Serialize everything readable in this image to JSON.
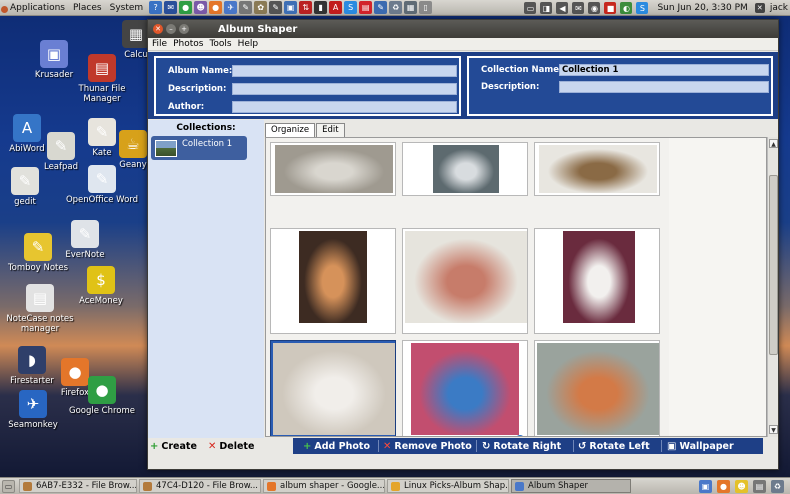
{
  "top_panel": {
    "menus": [
      "Applications",
      "Places",
      "System"
    ],
    "launchers": [
      {
        "icon": "help-icon",
        "glyph": "?",
        "color": "#3a72c4"
      },
      {
        "icon": "thunderbird-icon",
        "glyph": "✉",
        "color": "#2a4f9a"
      },
      {
        "icon": "chrome-icon",
        "glyph": "●",
        "color": "#2f9e44"
      },
      {
        "icon": "pidgin-icon",
        "glyph": "☻",
        "color": "#7a5aa8"
      },
      {
        "icon": "firefox-icon",
        "glyph": "●",
        "color": "#e4762a"
      },
      {
        "icon": "plane-icon",
        "glyph": "✈",
        "color": "#4a78c9"
      },
      {
        "icon": "text-editor-icon",
        "glyph": "✎",
        "color": "#777"
      },
      {
        "icon": "gimp-icon",
        "glyph": "✿",
        "color": "#8a7a55"
      },
      {
        "icon": "edit-icon",
        "glyph": "✎",
        "color": "#555"
      },
      {
        "icon": "monitor-icon",
        "glyph": "▣",
        "color": "#3e6fb5"
      },
      {
        "icon": "filezilla-icon",
        "glyph": "⇅",
        "color": "#b22"
      },
      {
        "icon": "terminal-icon",
        "glyph": "▮",
        "color": "#333"
      },
      {
        "icon": "acrobat-icon",
        "glyph": "A",
        "color": "#c21d1d"
      },
      {
        "icon": "skype-icon",
        "glyph": "S",
        "color": "#2a8be0"
      },
      {
        "icon": "pdf-icon",
        "glyph": "▤",
        "color": "#d2232a"
      },
      {
        "icon": "writer-icon",
        "glyph": "✎",
        "color": "#3c6bb0"
      },
      {
        "icon": "trash-icon",
        "glyph": "♻",
        "color": "#6d7b8d"
      },
      {
        "icon": "calculator-icon",
        "glyph": "▦",
        "color": "#5f6b75"
      },
      {
        "icon": "file-icon",
        "glyph": "▯",
        "color": "#8a8a8a"
      }
    ],
    "tray": [
      {
        "icon": "battery-icon",
        "glyph": "▭",
        "color": "#555"
      },
      {
        "icon": "network-icon",
        "glyph": "◨",
        "color": "#555"
      },
      {
        "icon": "volume-icon",
        "glyph": "◀",
        "color": "#555"
      },
      {
        "icon": "mail-icon",
        "glyph": "✉",
        "color": "#555"
      },
      {
        "icon": "wifi-icon",
        "glyph": "◉",
        "color": "#555"
      },
      {
        "icon": "record-icon",
        "glyph": "■",
        "color": "#c6281e"
      },
      {
        "icon": "chat-icon",
        "glyph": "◐",
        "color": "#3c8d3c"
      },
      {
        "icon": "skype-tray-icon",
        "glyph": "S",
        "color": "#2a8be0"
      }
    ],
    "clock": "Sun Jun 20,  3:30 PM",
    "user": "jack"
  },
  "desktop_icons": [
    {
      "name": "krusader",
      "label": "Krusader",
      "glyph": "▣",
      "color": "#6a7fd3"
    },
    {
      "name": "calculator",
      "label": "Calcu",
      "glyph": "▦",
      "color": "#444"
    },
    {
      "name": "thunar",
      "label": "Thunar File Manager",
      "glyph": "▤",
      "color": "#c0392b"
    },
    {
      "name": "abiword",
      "label": "AbiWord",
      "glyph": "A",
      "color": "#3575c7"
    },
    {
      "name": "leafpad",
      "label": "Leafpad",
      "glyph": "✎",
      "color": "#d8d8d0"
    },
    {
      "name": "kate",
      "label": "Kate",
      "glyph": "✎",
      "color": "#e7e4dd"
    },
    {
      "name": "geany",
      "label": "Geany",
      "glyph": "☕",
      "color": "#d7a11a"
    },
    {
      "name": "gedit",
      "label": "gedit",
      "glyph": "✎",
      "color": "#e1e1dc"
    },
    {
      "name": "openoffice-writer",
      "label": "OpenOffice Word",
      "glyph": "✎",
      "color": "#dfe6ef"
    },
    {
      "name": "tomboy",
      "label": "Tomboy Notes",
      "glyph": "✎",
      "color": "#e7c52f"
    },
    {
      "name": "evernote",
      "label": "EverNote",
      "glyph": "✎",
      "color": "#dfe3e8"
    },
    {
      "name": "acemoney",
      "label": "AceMoney",
      "glyph": "$",
      "color": "#e0c216"
    },
    {
      "name": "notecase",
      "label": "NoteCase notes manager",
      "glyph": "▤",
      "color": "#e2e2e2"
    },
    {
      "name": "firestarter",
      "label": "Firestarter",
      "glyph": "◗",
      "color": "#2f3f6a"
    },
    {
      "name": "firefox",
      "label": "Firefox",
      "glyph": "●",
      "color": "#e4762a"
    },
    {
      "name": "seamonkey",
      "label": "Seamonkey",
      "glyph": "✈",
      "color": "#2866c2"
    },
    {
      "name": "chrome",
      "label": "Google Chrome",
      "glyph": "●",
      "color": "#2f9e44"
    }
  ],
  "window": {
    "title": "Album Shaper",
    "menu": [
      "File",
      "Photos",
      "Tools",
      "Help"
    ],
    "album": {
      "name_label": "Album Name:",
      "name_value": "",
      "description_label": "Description:",
      "description_value": "",
      "author_label": "Author:",
      "author_value": ""
    },
    "collection": {
      "name_label": "Collection Name:",
      "name_value": "Collection 1",
      "description_label": "Description:",
      "description_value": ""
    },
    "collections_heading": "Collections:",
    "collections": [
      {
        "label": "Collection 1"
      }
    ],
    "tabs": [
      "Organize",
      "Edit"
    ],
    "photos": [
      {
        "name": "photo-computer-desk",
        "selected": false,
        "bg": "#9f9a90",
        "fg": "#d9d6cf"
      },
      {
        "name": "photo-deck-scene",
        "selected": false,
        "bg": "#5d6a6f",
        "fg": "#d8dcdf"
      },
      {
        "name": "photo-door-wreath",
        "selected": false,
        "bg": "#e8e6e0",
        "fg": "#8a6a45"
      },
      {
        "name": "photo-lamp-flowers",
        "selected": false,
        "bg": "#3d2b22",
        "fg": "#d6925a"
      },
      {
        "name": "photo-white-pillows",
        "selected": false,
        "bg": "#e6e4dd",
        "fg": "#c77c6a"
      },
      {
        "name": "photo-wedding-couple",
        "selected": false,
        "bg": "#6a2b3e",
        "fg": "#f2f0ee"
      },
      {
        "name": "photo-family-couch",
        "selected": true,
        "bg": "#cfc8bd",
        "fg": "#f1eeea"
      },
      {
        "name": "photo-baby-hat",
        "selected": false,
        "bg": "#c24e6f",
        "fg": "#3b7bc5"
      },
      {
        "name": "photo-office-computer",
        "selected": false,
        "bg": "#9aa39d",
        "fg": "#d37a47"
      }
    ],
    "info_badge": "i",
    "buttons": {
      "create": "Create",
      "delete": "Delete",
      "add_photo": "Add Photo",
      "remove_photo": "Remove Photo",
      "rotate_right": "Rotate Right",
      "rotate_left": "Rotate Left",
      "wallpaper": "Wallpaper"
    }
  },
  "taskbar": [
    {
      "label": "6AB7-E332 - File Brow...",
      "color": "#b37a3b",
      "active": false
    },
    {
      "label": "47C4-D120 - File Brow...",
      "color": "#b37a3b",
      "active": false
    },
    {
      "label": "album shaper - Google...",
      "color": "#e4762a",
      "active": false
    },
    {
      "label": "Linux Picks-Album Shap...",
      "color": "#e4a52a",
      "active": false
    },
    {
      "label": "Album Shaper",
      "color": "#4a78c9",
      "active": true
    }
  ],
  "taskbar_tray": [
    {
      "icon": "workspace-icon",
      "glyph": "▣",
      "color": "#4a78c9"
    },
    {
      "icon": "firefox-task-icon",
      "glyph": "●",
      "color": "#e4762a"
    },
    {
      "icon": "yellow-task-icon",
      "glyph": "☻",
      "color": "#e4c12a"
    },
    {
      "icon": "window-task-icon",
      "glyph": "▤",
      "color": "#777"
    },
    {
      "icon": "trash-task-icon",
      "glyph": "♻",
      "color": "#6d7b8d"
    }
  ]
}
